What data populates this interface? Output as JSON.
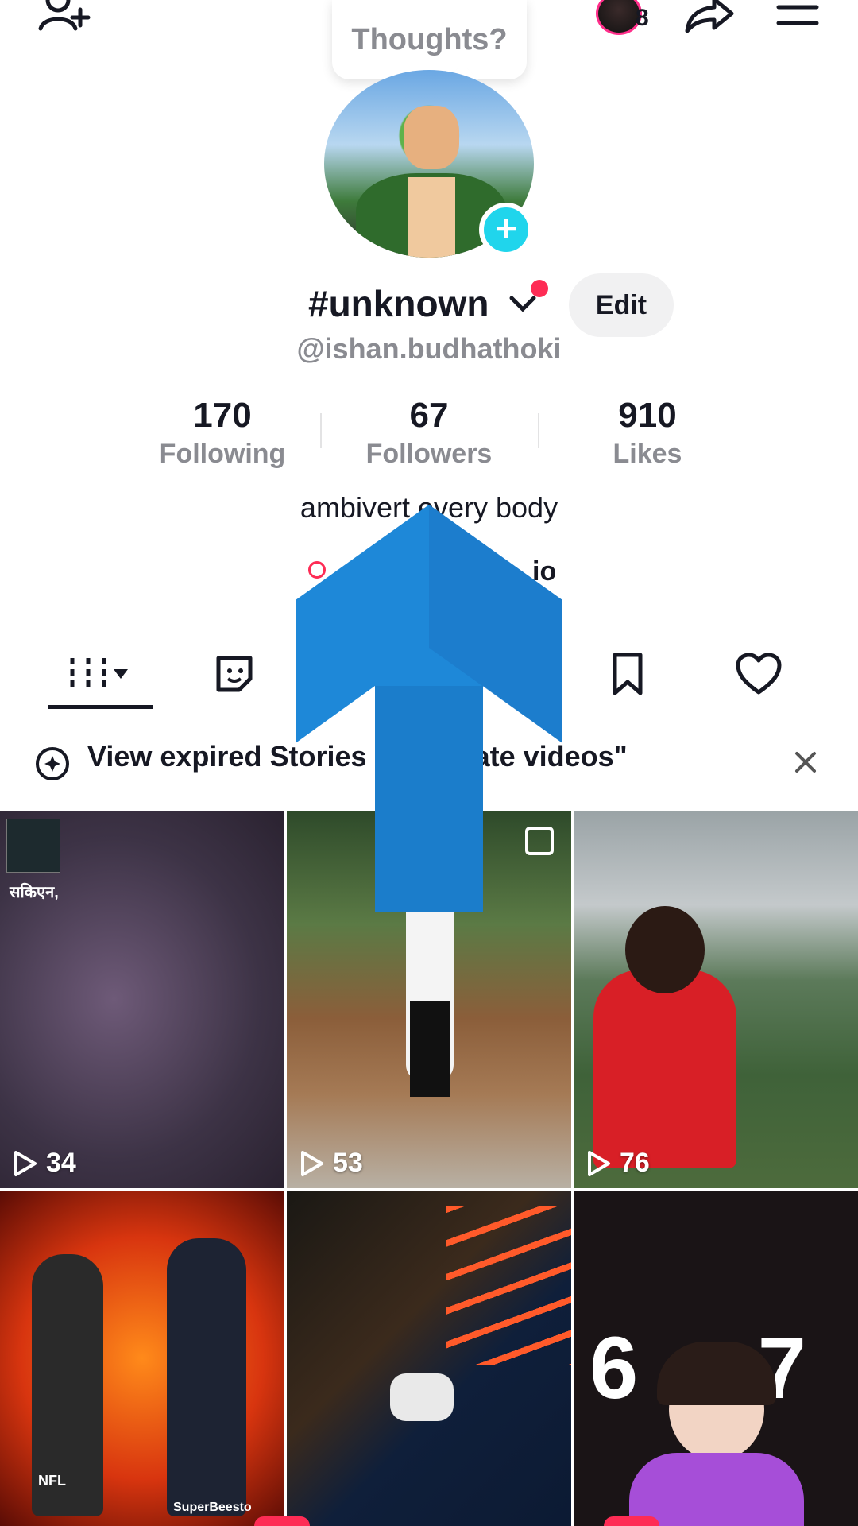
{
  "top_bar": {
    "add_friend_icon": "add-user-icon",
    "thoughts_label": "Thoughts?",
    "profile_views_count": "8",
    "share_icon": "share-icon",
    "menu_icon": "menu-icon"
  },
  "profile": {
    "display_name": "#unknown",
    "handle": "@ishan.budhathoki",
    "edit_label": "Edit",
    "bio": "ambivert every body",
    "link_text": "io"
  },
  "stats": [
    {
      "value": "170",
      "label": "Following"
    },
    {
      "value": "67",
      "label": "Followers"
    },
    {
      "value": "910",
      "label": "Likes"
    }
  ],
  "tabs": [
    {
      "name": "videos",
      "icon": "grid-icon"
    },
    {
      "name": "stickers",
      "icon": "sticker-icon"
    },
    {
      "name": "saved",
      "icon": "bookmark-icon"
    },
    {
      "name": "liked",
      "icon": "heart-icon"
    }
  ],
  "stories_banner": {
    "text": "View expired Stories in \"private videos\""
  },
  "grid": [
    {
      "views": "34",
      "overlay": "सकिएन,"
    },
    {
      "views": "53"
    },
    {
      "views": "76"
    },
    {
      "views": "",
      "overlay_left": "NFL",
      "overlay_right": "SuperBeesto"
    },
    {
      "views": ""
    },
    {
      "views": "",
      "overlay_text": "6   7"
    }
  ],
  "colors": {
    "accent_red": "#fe2c55",
    "accent_cyan": "#20d5ec",
    "text_primary": "#161823",
    "text_secondary": "#8a8b91",
    "overlay_arrow": "#1e88d8"
  }
}
